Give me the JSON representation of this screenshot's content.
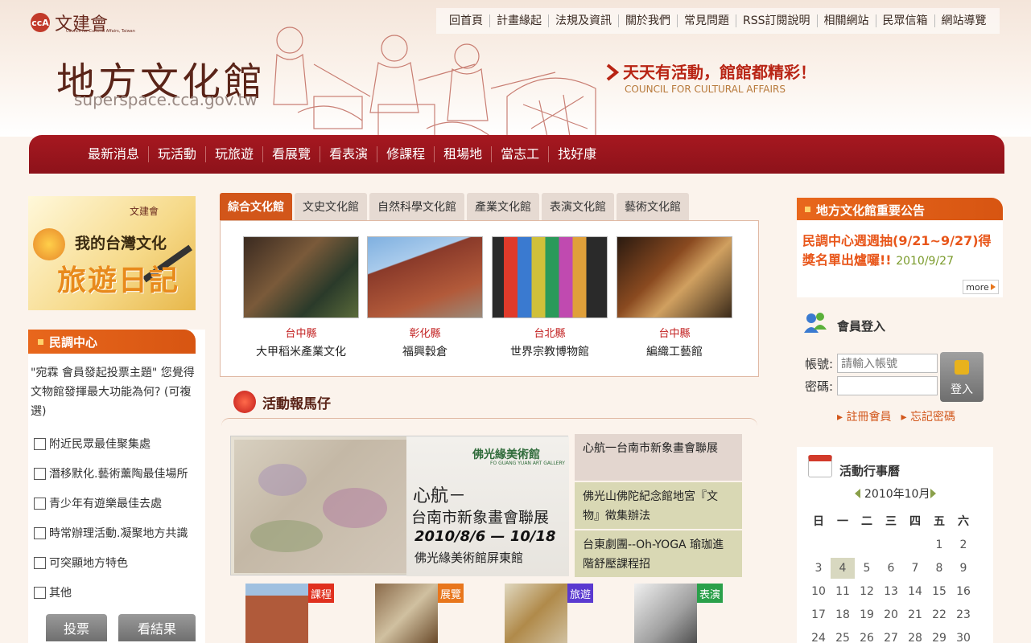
{
  "header": {
    "logo_text": "文建會",
    "logo_sub": "Council for Cultural Affairs, Taiwan",
    "seal": "ccA",
    "site_title": "地方文化館",
    "site_url": "superspace.cca.gov.tw",
    "slogan": "天天有活動，館館都精彩！",
    "slogan_en": "COUNCIL FOR CULTURAL AFFAIRS"
  },
  "top_nav": [
    "回首頁",
    "計畫緣起",
    "法規及資訊",
    "關於我們",
    "常見問題",
    "RSS訂閱說明",
    "相關網站",
    "民眾信箱",
    "網站導覽"
  ],
  "main_nav": [
    "最新消息",
    "玩活動",
    "玩旅遊",
    "看展覽",
    "看表演",
    "修課程",
    "租場地",
    "當志工",
    "找好康"
  ],
  "left": {
    "banner": {
      "seal": "文建會",
      "line1": "我的台灣文化",
      "line2": "旅遊日記"
    },
    "poll": {
      "title": "民調中心",
      "question": "\"宛霖 會員發起投票主題\" 您覺得文物館發揮最大功能為何? (可複選)",
      "options": [
        "附近民眾最佳聚集處",
        "潛移默化.藝術薰陶最佳場所",
        "青少年有遊樂最佳去處",
        "時常辦理活動.凝聚地方共識",
        "可突顯地方特色",
        "其他"
      ],
      "vote_label": "投票",
      "result_label": "看結果"
    }
  },
  "center": {
    "tabs": [
      "綜合文化館",
      "文史文化館",
      "自然科學文化館",
      "產業文化館",
      "表演文化館",
      "藝術文化館"
    ],
    "venues": [
      {
        "county": "台中縣",
        "name": "大甲稻米產業文化"
      },
      {
        "county": "彰化縣",
        "name": "福興穀倉"
      },
      {
        "county": "台北縣",
        "name": "世界宗教博物館"
      },
      {
        "county": "台中縣",
        "name": "編織工藝館"
      }
    ],
    "activities": {
      "title": "活動報馬仔",
      "banner": {
        "gallery": "佛光緣美術館",
        "gallery_en": "FO GUANG YUAN ART GALLERY",
        "line1": "心航－",
        "line2": "台南市新象畫會聯展",
        "line3": "2010/8/6 — 10/18",
        "line4": "佛光緣美術館屏東館"
      },
      "items": [
        "心航一台南市新象畫會聯展",
        "佛光山佛陀紀念館地宮『文物』徵集辦法",
        "台東劇團--Oh-YOGA 瑜珈進階舒壓課程招"
      ],
      "thumbs": [
        {
          "tag": "課程",
          "color": "#e0301e"
        },
        {
          "tag": "展覽",
          "color": "#e8761c"
        },
        {
          "tag": "旅遊",
          "color": "#5a3ad0"
        },
        {
          "tag": "表演",
          "color": "#2aa04a"
        }
      ]
    }
  },
  "right": {
    "announce": {
      "title": "地方文化館重要公告",
      "text": "民調中心週週抽(9/21~9/27)得獎名單出爐囉!!",
      "date": "2010/9/27",
      "more": "more"
    },
    "login": {
      "title": "會員登入",
      "account_label": "帳號:",
      "account_placeholder": "請輸入帳號",
      "password_label": "密碼:",
      "button": "登入",
      "register": "註冊會員",
      "forgot": "忘記密碼"
    },
    "calendar": {
      "title": "活動行事曆",
      "month": "2010年10月",
      "weekdays": [
        "日",
        "一",
        "二",
        "三",
        "四",
        "五",
        "六"
      ],
      "weeks": [
        [
          "",
          "",
          "",
          "",
          "",
          "1",
          "2"
        ],
        [
          "3",
          "4",
          "5",
          "6",
          "7",
          "8",
          "9"
        ],
        [
          "10",
          "11",
          "12",
          "13",
          "14",
          "15",
          "16"
        ],
        [
          "17",
          "18",
          "19",
          "20",
          "21",
          "22",
          "23"
        ],
        [
          "24",
          "25",
          "26",
          "27",
          "28",
          "29",
          "30"
        ]
      ],
      "today": "4"
    }
  },
  "colors": {
    "nav_red": "#9b1620",
    "accent_orange": "#d75512",
    "county_red": "#c21f1f"
  }
}
